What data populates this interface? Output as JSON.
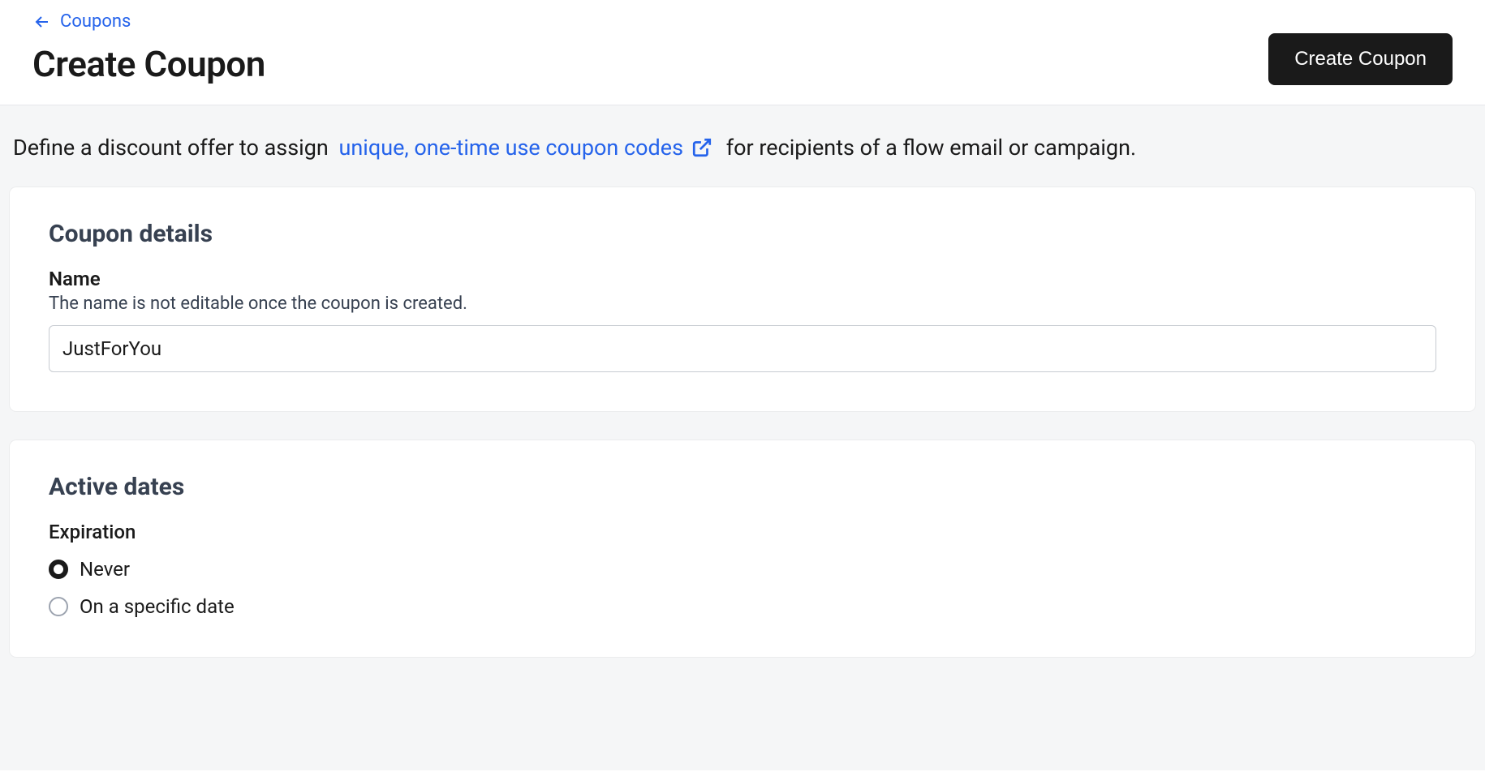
{
  "breadcrumb": {
    "label": "Coupons"
  },
  "page": {
    "title": "Create Coupon"
  },
  "actions": {
    "create_button": "Create Coupon"
  },
  "intro": {
    "prefix": "Define a discount offer to assign",
    "link_text": "unique, one-time use coupon codes",
    "suffix": "for recipients of a flow email or campaign."
  },
  "coupon_details": {
    "section_title": "Coupon details",
    "name_label": "Name",
    "name_help": "The name is not editable once the coupon is created.",
    "name_value": "JustForYou"
  },
  "active_dates": {
    "section_title": "Active dates",
    "expiration_label": "Expiration",
    "options": {
      "never": "Never",
      "specific": "On a specific date"
    },
    "selected": "never"
  }
}
